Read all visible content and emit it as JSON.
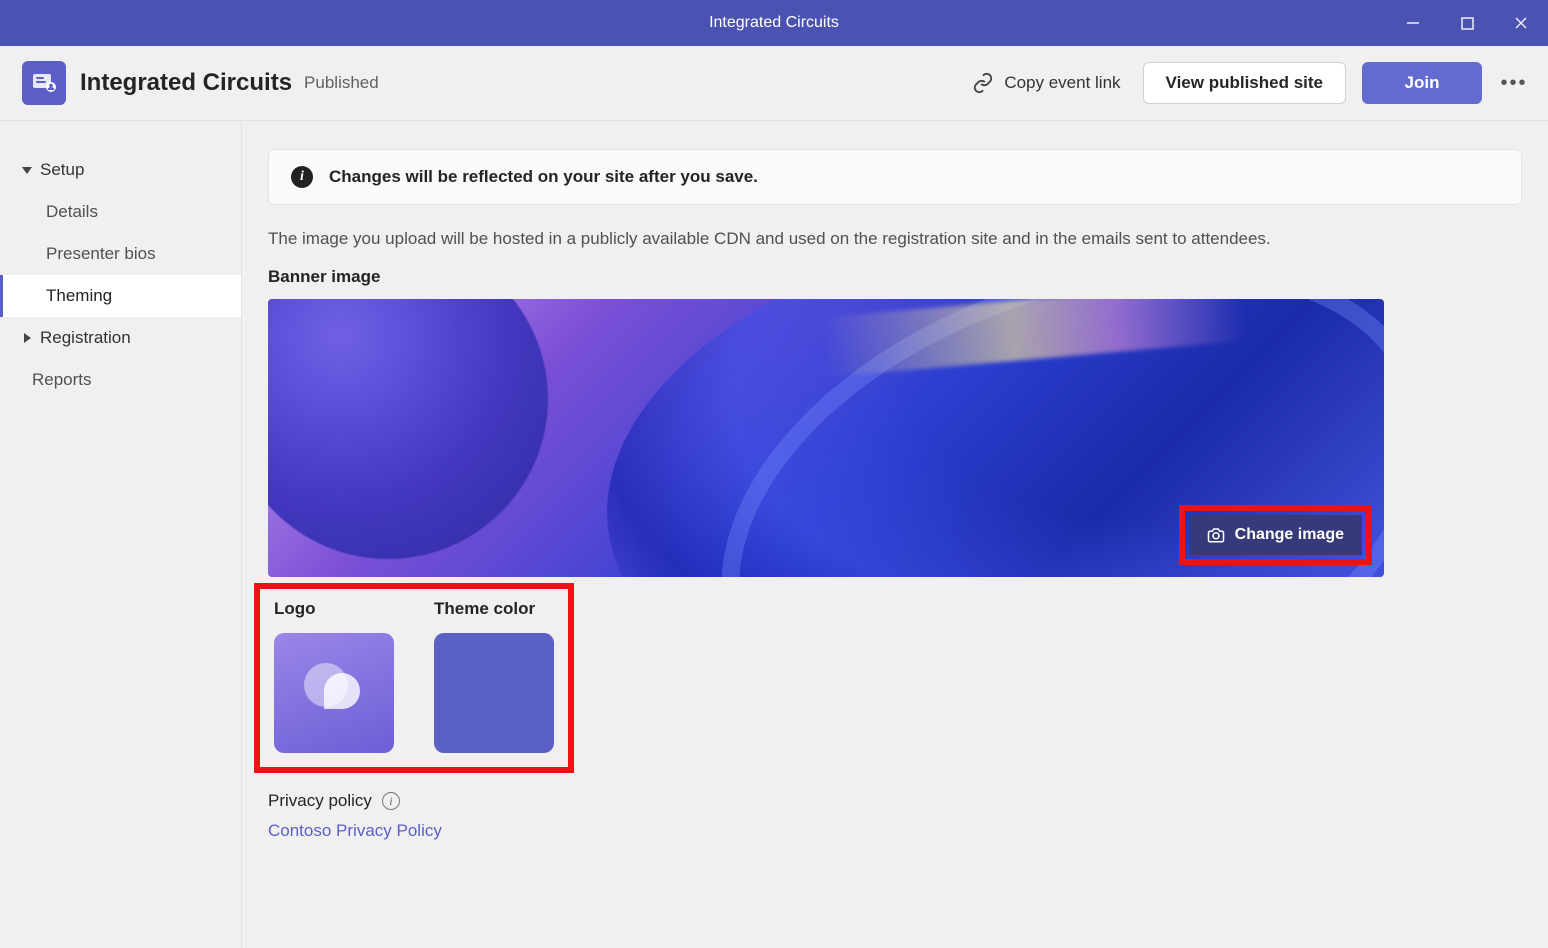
{
  "window": {
    "title": "Integrated Circuits"
  },
  "header": {
    "page_title": "Integrated Circuits",
    "status": "Published",
    "copy_link_label": "Copy event link",
    "view_site_label": "View published site",
    "join_label": "Join"
  },
  "sidebar": {
    "setup_label": "Setup",
    "items": [
      {
        "label": "Details"
      },
      {
        "label": "Presenter bios"
      },
      {
        "label": "Theming"
      }
    ],
    "registration_label": "Registration",
    "reports_label": "Reports"
  },
  "notice": {
    "text": "Changes will be reflected on your site after you save."
  },
  "main": {
    "description": "The image you upload will be hosted in a publicly available CDN and used on the registration site and in the emails sent to attendees.",
    "banner_label": "Banner image",
    "change_image_label": "Change image",
    "logo_label": "Logo",
    "theme_color_label": "Theme color",
    "privacy_label": "Privacy policy",
    "privacy_link_text": "Contoso Privacy Policy"
  },
  "colors": {
    "theme": "#5b61c4"
  }
}
